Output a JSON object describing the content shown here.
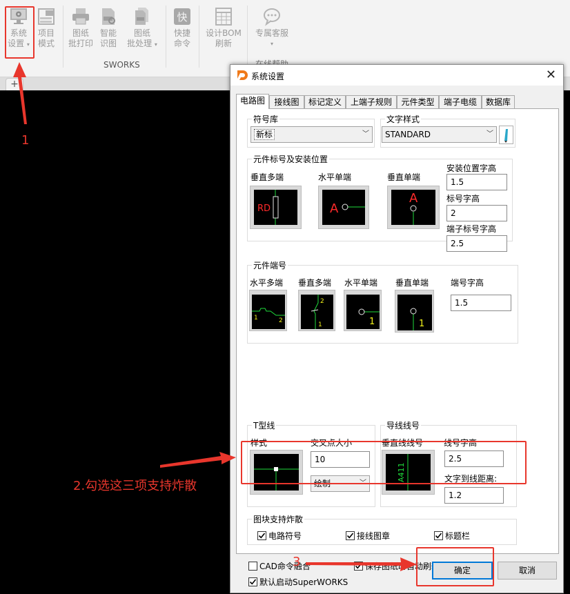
{
  "ribbon": {
    "buttons": [
      {
        "label1": "系统",
        "label2": "设置",
        "icon": "monitor-gear-icon"
      },
      {
        "label1": "项目",
        "label2": "模式",
        "icon": "dwg-project-icon"
      },
      {
        "label1": "图纸",
        "label2": "批打印",
        "icon": "printer-icon"
      },
      {
        "label1": "智能",
        "label2": "识图",
        "icon": "dwg-recognize-icon"
      },
      {
        "label1": "图纸",
        "label2": "批处理",
        "icon": "dwg-batch-icon"
      },
      {
        "label1": "快捷",
        "label2": "命令",
        "icon": "quick-command-icon"
      },
      {
        "label1": "设计BOM",
        "label2": "刷新",
        "icon": "bom-table-icon"
      },
      {
        "label1": "专属客服",
        "label2": "",
        "icon": "chat-bubble-icon"
      }
    ],
    "group_label": "SWORKS",
    "group_label2": "在线帮助",
    "tab_plus": "+"
  },
  "dialog": {
    "title": "系统设置",
    "tabs": [
      "电路图",
      "接线图",
      "标记定义",
      "上端子规则",
      "元件类型",
      "端子电缆",
      "数据库"
    ],
    "symbol_lib": {
      "legend": "符号库",
      "value": "新标"
    },
    "text_style": {
      "legend": "文字样式",
      "value": "STANDARD"
    },
    "comp_label": {
      "legend": "元件标号及安装位置",
      "previews": [
        "垂直多端",
        "水平单端",
        "垂直单端"
      ],
      "fields": [
        {
          "label": "安装位置字高",
          "value": "1.5"
        },
        {
          "label": "标号字高",
          "value": "2"
        },
        {
          "label": "端子标号字高",
          "value": "2.5"
        }
      ]
    },
    "comp_terminal": {
      "legend": "元件端号",
      "previews": [
        "水平多端",
        "垂直多端",
        "水平单端",
        "垂直单端"
      ],
      "field": {
        "label": "端号字高",
        "value": "1.5"
      }
    },
    "tline": {
      "legend": "T型线",
      "style_label": "样式",
      "cross_label": "交叉点大小",
      "cross_value": "10",
      "draw_value": "绘制"
    },
    "wire_label": {
      "legend": "导线线号",
      "vertical_label": "垂直线线号",
      "height_label": "线号字高",
      "height_value": "2.5",
      "dist_label": "文字到线距离:",
      "dist_value": "1.2"
    },
    "explode": {
      "legend": "图块支持炸散",
      "items": [
        "电路符号",
        "接线图章",
        "标题栏"
      ]
    },
    "options": [
      "CAD命令融合",
      "保存图纸时自动刷新设计BOM",
      "默认启动SuperWORKS"
    ],
    "ok": "确定",
    "cancel": "取消"
  },
  "preview_text": {
    "rd": "RD",
    "a": "A",
    "a411": "A411",
    "t1": "1",
    "t2": "2"
  },
  "annotations": {
    "step1": "1",
    "step2": "2.勾选这三项支持炸散",
    "step3": "3"
  },
  "colors": {
    "annotation": "#e8362c",
    "preview_bg": "#000000",
    "wire_green": "#1fdc3c",
    "label_red": "#ff2a2a",
    "terminal_yellow": "#f2f21a",
    "focus_blue": "#0078d7"
  }
}
